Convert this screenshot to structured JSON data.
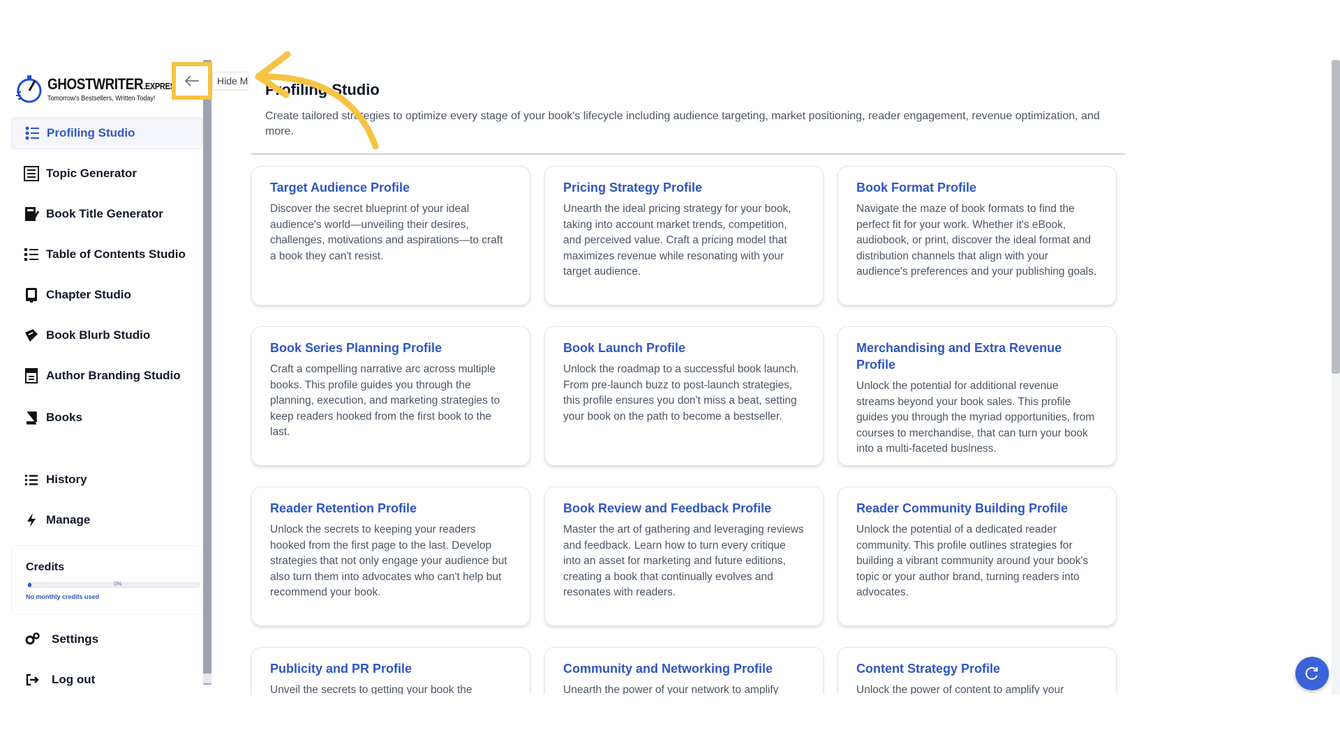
{
  "brand": {
    "wordmark_main": "GHOSTWRITER",
    "wordmark_suffix": ".EXPRESS",
    "tagline": "Tomorrow's Bestsellers, Written Today!"
  },
  "sidebar": {
    "collapse_tooltip": "Hide Menu",
    "items": [
      {
        "label": "Profiling Studio",
        "icon": "profiling-icon"
      },
      {
        "label": "Topic Generator",
        "icon": "topic-icon"
      },
      {
        "label": "Book Title Generator",
        "icon": "title-icon"
      },
      {
        "label": "Table of Contents Studio",
        "icon": "toc-icon"
      },
      {
        "label": "Chapter Studio",
        "icon": "chapter-icon"
      },
      {
        "label": "Book Blurb Studio",
        "icon": "blurb-icon"
      },
      {
        "label": "Author Branding Studio",
        "icon": "branding-icon"
      },
      {
        "label": "Books",
        "icon": "book-icon"
      },
      {
        "label": "History",
        "icon": "list-icon"
      },
      {
        "label": "Manage",
        "icon": "bolt-icon"
      },
      {
        "label": "Settings",
        "icon": "gears-icon"
      },
      {
        "label": "Log out",
        "icon": "logout-icon"
      }
    ],
    "credits": {
      "title": "Credits",
      "percent_label": "0%",
      "progress": 0.02,
      "note": "No monthly credits used"
    }
  },
  "main": {
    "title": "Profiling Studio",
    "description": "Create tailored strategies to optimize every stage of your book's lifecycle including audience targeting, market positioning, reader engagement, revenue optimization, and more.",
    "cards": [
      {
        "title": "Target Audience Profile",
        "desc": "Discover the secret blueprint of your ideal audience's world—unveiling their desires, challenges, motivations and aspirations—to craft a book they can't resist."
      },
      {
        "title": "Pricing Strategy Profile",
        "desc": "Unearth the ideal pricing strategy for your book, taking into account market trends, competition, and perceived value. Craft a pricing model that maximizes revenue while resonating with your target audience."
      },
      {
        "title": "Book Format Profile",
        "desc": "Navigate the maze of book formats to find the perfect fit for your work. Whether it's eBook, audiobook, or print, discover the ideal format and distribution channels that align with your audience's preferences and your publishing goals."
      },
      {
        "title": "Book Series Planning Profile",
        "desc": "Craft a compelling narrative arc across multiple books. This profile guides you through the planning, execution, and marketing strategies to keep readers hooked from the first book to the last."
      },
      {
        "title": "Book Launch Profile",
        "desc": "Unlock the roadmap to a successful book launch. From pre-launch buzz to post-launch strategies, this profile ensures you don't miss a beat, setting your book on the path to become a bestseller."
      },
      {
        "title": "Merchandising and Extra Revenue Profile",
        "desc": "Unlock the potential for additional revenue streams beyond your book sales. This profile guides you through the myriad opportunities, from courses to merchandise, that can turn your book into a multi-faceted business."
      },
      {
        "title": "Reader Retention Profile",
        "desc": "Unlock the secrets to keeping your readers hooked from the first page to the last. Develop strategies that not only engage your audience but also turn them into advocates who can't help but recommend your book."
      },
      {
        "title": "Book Review and Feedback Profile",
        "desc": "Master the art of gathering and leveraging reviews and feedback. Learn how to turn every critique into an asset for marketing and future editions, creating a book that continually evolves and resonates with readers."
      },
      {
        "title": "Reader Community Building Profile",
        "desc": "Unlock the potential of a dedicated reader community. This profile outlines strategies for building a vibrant community around your book's topic or your author brand, turning readers into advocates."
      },
      {
        "title": "Publicity and PR Profile",
        "desc": "Unveil the secrets to getting your book the"
      },
      {
        "title": "Community and Networking Profile",
        "desc": "Unearth the power of your network to amplify"
      },
      {
        "title": "Content Strategy Profile",
        "desc": "Unlock the power of content to amplify your"
      }
    ]
  },
  "colors": {
    "accent": "#2f56c4",
    "annotation": "#f6c343",
    "fab": "#3b63d8"
  }
}
